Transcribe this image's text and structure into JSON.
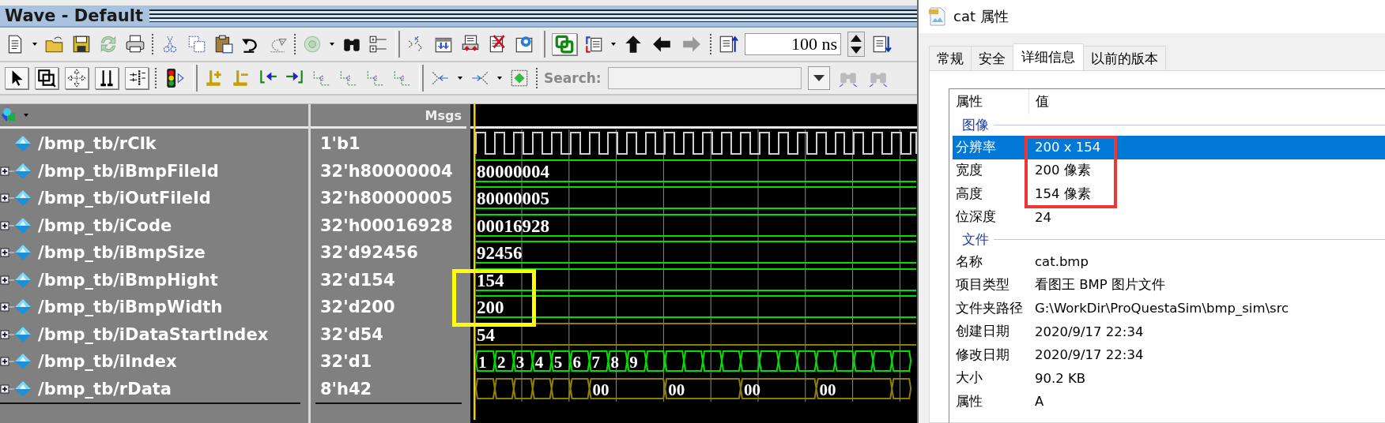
{
  "wave_window": {
    "title": "Wave - Default",
    "time_step": "100 ns",
    "search_label": "Search:",
    "msgs_header": "Msgs",
    "signals": [
      {
        "name": "/bmp_tb/rClk",
        "value": "1'b1",
        "expandable": false,
        "highlighted": false,
        "wave": {
          "kind": "clock",
          "color": "#d0d0d0"
        }
      },
      {
        "name": "/bmp_tb/iBmpFileId",
        "value": "32'h80000004",
        "expandable": true,
        "highlighted": false,
        "wave": {
          "kind": "bus",
          "color": "#00e000",
          "labels": [
            "80000004"
          ]
        }
      },
      {
        "name": "/bmp_tb/iOutFileId",
        "value": "32'h80000005",
        "expandable": true,
        "highlighted": false,
        "wave": {
          "kind": "bus",
          "color": "#00e000",
          "labels": [
            "80000005"
          ]
        }
      },
      {
        "name": "/bmp_tb/iCode",
        "value": "32'h00016928",
        "expandable": true,
        "highlighted": false,
        "wave": {
          "kind": "bus",
          "color": "#00e000",
          "labels": [
            "00016928"
          ]
        }
      },
      {
        "name": "/bmp_tb/iBmpSize",
        "value": "32'd92456",
        "expandable": true,
        "highlighted": false,
        "wave": {
          "kind": "bus",
          "color": "#00e000",
          "labels": [
            "92456"
          ]
        }
      },
      {
        "name": "/bmp_tb/iBmpHight",
        "value": "32'd154",
        "expandable": true,
        "highlighted": true,
        "wave": {
          "kind": "bus",
          "color": "#00e000",
          "labels": [
            "154"
          ]
        }
      },
      {
        "name": "/bmp_tb/iBmpWidth",
        "value": "32'd200",
        "expandable": true,
        "highlighted": true,
        "wave": {
          "kind": "bus",
          "color": "#00e000",
          "labels": [
            "200"
          ]
        }
      },
      {
        "name": "/bmp_tb/iDataStartIndex",
        "value": "32'd54",
        "expandable": true,
        "highlighted": false,
        "wave": {
          "kind": "bus",
          "color": "#8c8000",
          "labels": [
            "54"
          ]
        }
      },
      {
        "name": "/bmp_tb/iIndex",
        "value": "32'd1",
        "expandable": true,
        "highlighted": false,
        "wave": {
          "kind": "counter",
          "color": "#00e000",
          "labels": [
            "1",
            "2",
            "3",
            "4",
            "5",
            "6",
            "7",
            "8",
            "9"
          ]
        }
      },
      {
        "name": "/bmp_tb/rData",
        "value": "8'h42",
        "expandable": true,
        "highlighted": false,
        "wave": {
          "kind": "toggle",
          "color": "#8c8000",
          "labels": [
            "00",
            "00",
            "00",
            "00"
          ]
        }
      }
    ]
  },
  "properties_dialog": {
    "title": "cat 属性",
    "tabs": [
      {
        "label": "常规",
        "selected": false
      },
      {
        "label": "安全",
        "selected": false
      },
      {
        "label": "详细信息",
        "selected": true
      },
      {
        "label": "以前的版本",
        "selected": false
      }
    ],
    "columns": [
      "属性",
      "值"
    ],
    "groups": [
      {
        "label": "图像",
        "rows": [
          {
            "property": "分辨率",
            "value": "200 x 154",
            "selected": true,
            "highlighted": true
          },
          {
            "property": "宽度",
            "value": "200 像素",
            "selected": false,
            "highlighted": true
          },
          {
            "property": "高度",
            "value": "154 像素",
            "selected": false,
            "highlighted": true
          },
          {
            "property": "位深度",
            "value": "24",
            "selected": false,
            "highlighted": false
          }
        ]
      },
      {
        "label": "文件",
        "rows": [
          {
            "property": "名称",
            "value": "cat.bmp",
            "selected": false,
            "highlighted": false
          },
          {
            "property": "项目类型",
            "value": "看图王 BMP 图片文件",
            "selected": false,
            "highlighted": false
          },
          {
            "property": "文件夹路径",
            "value": "G:\\WorkDir\\ProQuestaSim\\bmp_sim\\src",
            "selected": false,
            "highlighted": false
          },
          {
            "property": "创建日期",
            "value": "2020/9/17 22:34",
            "selected": false,
            "highlighted": false
          },
          {
            "property": "修改日期",
            "value": "2020/9/17 22:34",
            "selected": false,
            "highlighted": false
          },
          {
            "property": "大小",
            "value": "90.2 KB",
            "selected": false,
            "highlighted": false
          },
          {
            "property": "属性",
            "value": "A",
            "selected": false,
            "highlighted": false
          }
        ]
      }
    ]
  }
}
